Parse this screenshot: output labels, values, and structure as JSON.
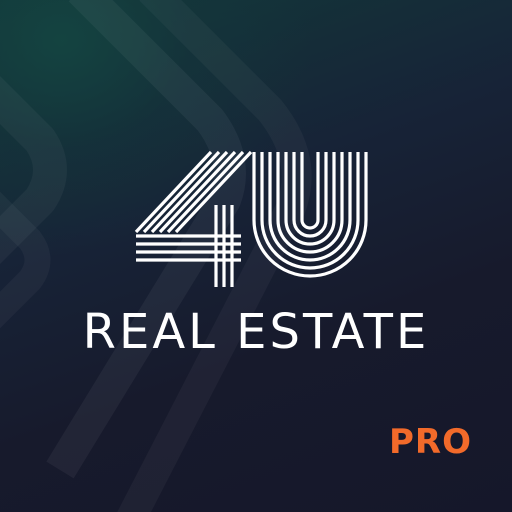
{
  "icon": {
    "brand_mark": "4U",
    "brand_name": "REAL ESTATE",
    "badge": "PRO"
  },
  "colors": {
    "background_dark": "#161a2a",
    "background_teal": "#123a3a",
    "logo_white": "#ffffff",
    "badge_orange": "#f26a2a"
  },
  "decorations": {
    "background_pattern": "chevron-arrow-icon"
  }
}
